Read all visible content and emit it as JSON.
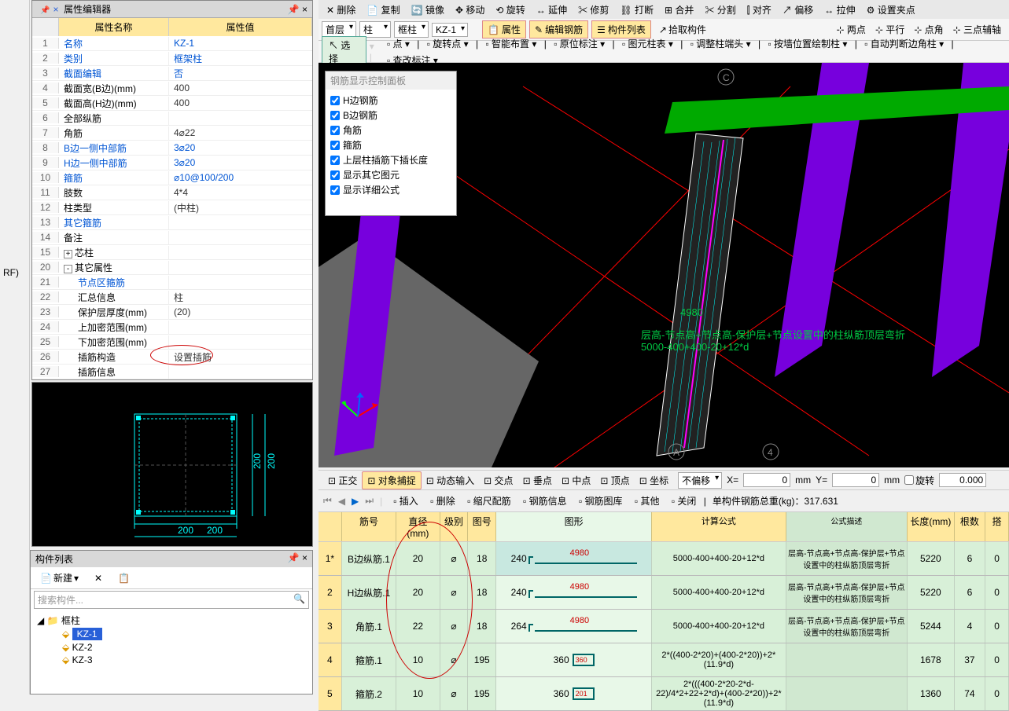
{
  "toolbar_top": {
    "items": [
      "删除",
      "复制",
      "镜像",
      "移动",
      "旋转",
      "延伸",
      "修剪",
      "打断",
      "合并",
      "分割",
      "对齐",
      "偏移",
      "拉伸",
      "设置夹点"
    ]
  },
  "toolbar_2": {
    "combo1": "首层",
    "combo2": "柱",
    "combo3": "框柱",
    "combo4": "KZ-1",
    "btn_props": "属性",
    "btn_editrebar": "编辑钢筋",
    "btn_complist": "构件列表",
    "btn_pick": "拾取构件",
    "snap_items": [
      "两点",
      "平行",
      "点角",
      "三点辅轴"
    ]
  },
  "toolbar_3": {
    "btn_select": "选择",
    "items": [
      "点",
      "旋转点",
      "智能布置",
      "原位标注",
      "图元柱表",
      "调整柱端头",
      "按墙位置绘制柱",
      "自动判断边角柱",
      "查改标注"
    ]
  },
  "prop_panel": {
    "title": "属性编辑器",
    "hdr_name": "属性名称",
    "hdr_val": "属性值",
    "rows": [
      {
        "n": "1",
        "name": "名称",
        "val": "KZ-1",
        "blue": true
      },
      {
        "n": "2",
        "name": "类别",
        "val": "框架柱",
        "blue": true
      },
      {
        "n": "3",
        "name": "截面编辑",
        "val": "否",
        "blue": true
      },
      {
        "n": "4",
        "name": "截面宽(B边)(mm)",
        "val": "400"
      },
      {
        "n": "5",
        "name": "截面高(H边)(mm)",
        "val": "400"
      },
      {
        "n": "6",
        "name": "全部纵筋",
        "val": ""
      },
      {
        "n": "7",
        "name": "角筋",
        "val": "4⌀22"
      },
      {
        "n": "8",
        "name": "B边一侧中部筋",
        "val": "3⌀20",
        "blue": true
      },
      {
        "n": "9",
        "name": "H边一侧中部筋",
        "val": "3⌀20",
        "blue": true
      },
      {
        "n": "10",
        "name": "箍筋",
        "val": "⌀10@100/200",
        "blue": true
      },
      {
        "n": "11",
        "name": "肢数",
        "val": "4*4"
      },
      {
        "n": "12",
        "name": "柱类型",
        "val": "(中柱)"
      },
      {
        "n": "13",
        "name": "其它箍筋",
        "val": "",
        "blue": true
      },
      {
        "n": "14",
        "name": "备注",
        "val": ""
      },
      {
        "n": "15",
        "name": "芯柱",
        "val": "",
        "exp": "+"
      },
      {
        "n": "20",
        "name": "其它属性",
        "val": "",
        "exp": "-"
      },
      {
        "n": "21",
        "name": "节点区箍筋",
        "val": "",
        "indent": true,
        "blue": true
      },
      {
        "n": "22",
        "name": "汇总信息",
        "val": "柱",
        "indent": true
      },
      {
        "n": "23",
        "name": "保护层厚度(mm)",
        "val": "(20)",
        "indent": true
      },
      {
        "n": "24",
        "name": "上加密范围(mm)",
        "val": "",
        "indent": true
      },
      {
        "n": "25",
        "name": "下加密范围(mm)",
        "val": "",
        "indent": true
      },
      {
        "n": "26",
        "name": "插筋构造",
        "val": "设置插筋",
        "indent": true
      },
      {
        "n": "27",
        "name": "插筋信息",
        "val": "",
        "indent": true
      }
    ]
  },
  "rebar_panel": {
    "title": "钢筋显示控制面板",
    "items": [
      "H边钢筋",
      "B边钢筋",
      "角筋",
      "箍筋",
      "上层柱插筋下插长度",
      "显示其它图元",
      "显示详细公式"
    ]
  },
  "section_dims": {
    "w": "200",
    "h": "200"
  },
  "comp_list": {
    "title": "构件列表",
    "btn_new": "新建",
    "search_ph": "搜索构件...",
    "root": "框柱",
    "items": [
      "KZ-1",
      "KZ-2",
      "KZ-3"
    ]
  },
  "viewport": {
    "dim_label": "4980",
    "formula_text": "层高-节点高+节点高-保护层+节点设置中的柱纵筋顶层弯折",
    "formula_calc": "5000-400+400-20+12*d"
  },
  "snap_bar": {
    "items": [
      "正交",
      "对象捕捉",
      "动态输入",
      "交点",
      "垂点",
      "中点",
      "顶点",
      "坐标"
    ],
    "combo_off": "不偏移",
    "x_lbl": "X=",
    "x_val": "0",
    "x_unit": "mm",
    "y_lbl": "Y=",
    "y_val": "0",
    "y_unit": "mm",
    "rot_lbl": "旋转",
    "rot_val": "0.000"
  },
  "rec_bar": {
    "items": [
      "插入",
      "删除",
      "缩尺配筋",
      "钢筋信息",
      "钢筋图库",
      "其他",
      "关闭"
    ],
    "total": "单构件钢筋总重(kg)：317.631"
  },
  "rebar_table": {
    "hdr": {
      "n": "",
      "name": "筋号",
      "dia": "直径(mm)",
      "lvl": "级别",
      "tuhao": "图号",
      "shape": "图形",
      "formula": "计算公式",
      "desc": "公式描述",
      "len": "长度(mm)",
      "cnt": "根数",
      "da": "搭"
    },
    "rows": [
      {
        "n": "1*",
        "name": "B边纵筋.1",
        "dia": "20",
        "lvl": "⌀",
        "tuhao": "18",
        "sh_l": "240",
        "sh_r": "4980",
        "formula": "5000-400+400-20+12*d",
        "desc": "层高-节点高+节点高-保护层+节点设置中的柱纵筋顶层弯折",
        "len": "5220",
        "cnt": "6",
        "da": "0"
      },
      {
        "n": "2",
        "name": "H边纵筋.1",
        "dia": "20",
        "lvl": "⌀",
        "tuhao": "18",
        "sh_l": "240",
        "sh_r": "4980",
        "formula": "5000-400+400-20+12*d",
        "desc": "层高-节点高+节点高-保护层+节点设置中的柱纵筋顶层弯折",
        "len": "5220",
        "cnt": "6",
        "da": "0"
      },
      {
        "n": "3",
        "name": "角筋.1",
        "dia": "22",
        "lvl": "⌀",
        "tuhao": "18",
        "sh_l": "264",
        "sh_r": "4980",
        "formula": "5000-400+400-20+12*d",
        "desc": "层高-节点高+节点高-保护层+节点设置中的柱纵筋顶层弯折",
        "len": "5244",
        "cnt": "4",
        "da": "0"
      },
      {
        "n": "4",
        "name": "箍筋.1",
        "dia": "10",
        "lvl": "⌀",
        "tuhao": "195",
        "sh_l": "360",
        "sh_r": "360",
        "formula": "2*((400-2*20)+(400-2*20))+2*(11.9*d)",
        "desc": "",
        "len": "1678",
        "cnt": "37",
        "da": "0"
      },
      {
        "n": "5",
        "name": "箍筋.2",
        "dia": "10",
        "lvl": "⌀",
        "tuhao": "195",
        "sh_l": "360",
        "sh_r": "201",
        "formula": "2*(((400-2*20-2*d-22)/4*2+22+2*d)+(400-2*20))+2*(11.9*d)",
        "desc": "",
        "len": "1360",
        "cnt": "74",
        "da": "0"
      }
    ]
  },
  "left_label": "RF)"
}
